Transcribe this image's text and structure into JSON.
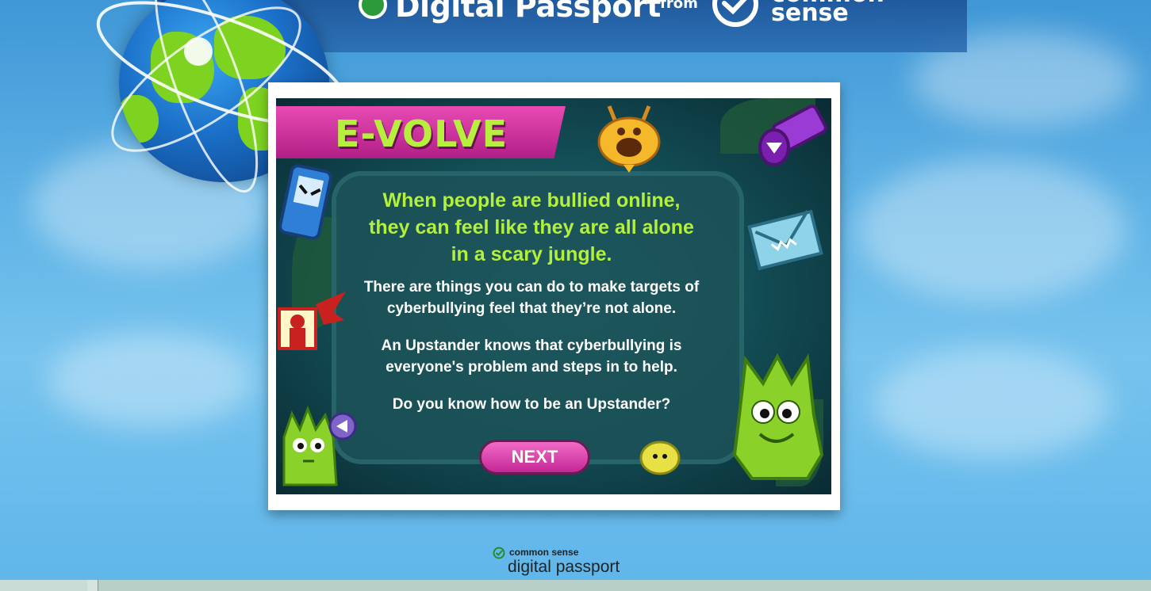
{
  "header": {
    "brand_title": "Digital Passport",
    "from_label": "from",
    "partner_line1": "common",
    "partner_line2": "sense"
  },
  "game": {
    "title": "E-VOLVE",
    "headline_lines": [
      "When people are bullied online,",
      "they can feel like they are all alone",
      "in a scary jungle."
    ],
    "paragraph1_lines": [
      "There are things you can do to make targets of",
      "cyberbullying feel that they’re not alone."
    ],
    "paragraph2_lines": [
      "An Upstander knows that cyberbullying is",
      "everyone's problem and steps in to help."
    ],
    "question": "Do you know how to be an Upstander?",
    "next_label": "NEXT"
  },
  "footer": {
    "brand_small": "common sense",
    "brand_name": "digital passport"
  },
  "colors": {
    "accent_green": "#b3f03e",
    "button_pink": "#d9359f",
    "sky_blue": "#5fb3e6"
  }
}
